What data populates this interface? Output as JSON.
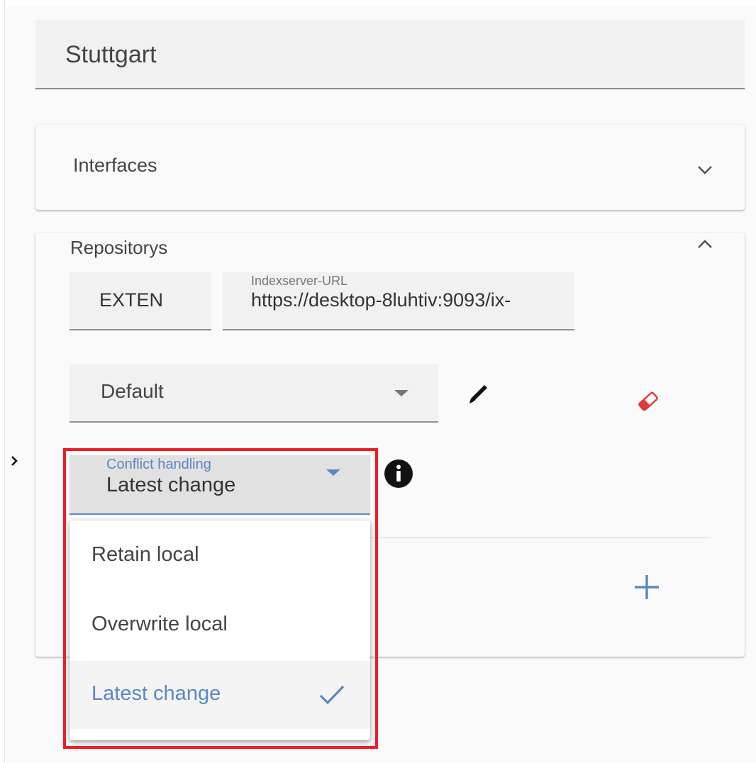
{
  "location": {
    "name": "Stuttgart"
  },
  "interfaces": {
    "title": "Interfaces",
    "chevron_icon": "chevron-down-icon"
  },
  "repositorys": {
    "title": "Repositorys",
    "chevron_icon": "chevron-up-icon",
    "exten_value": "EXTEN",
    "indexserver": {
      "label": "Indexserver-URL",
      "value": "https://desktop-8luhtiv:9093/ix-"
    },
    "profile_select": {
      "value": "Default"
    },
    "edit_icon": "pencil-icon",
    "delete_icon": "eraser-icon",
    "info_icon": "info-icon",
    "add_icon": "plus-icon"
  },
  "conflict_handling": {
    "label": "Conflict handling",
    "value": "Latest change",
    "options": [
      {
        "label": "Retain local",
        "selected": false
      },
      {
        "label": "Overwrite local",
        "selected": false
      },
      {
        "label": "Latest change",
        "selected": true
      }
    ]
  },
  "colors": {
    "accent_blue": "#5b87c6",
    "highlight_red": "#ee1c24",
    "eraser_red": "#e53935"
  }
}
